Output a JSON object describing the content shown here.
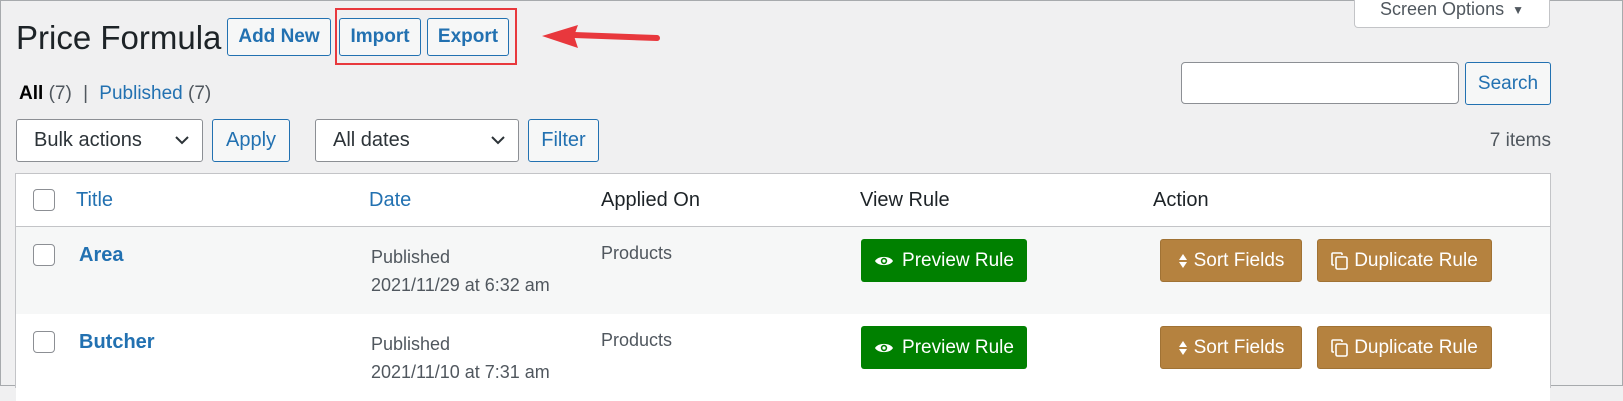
{
  "header": {
    "title": "Price Formula",
    "add_new": "Add New",
    "import": "Import",
    "export": "Export",
    "screen_options": "Screen Options"
  },
  "filters": {
    "all_label": "All",
    "all_count": "(7)",
    "separator": "|",
    "published_label": "Published",
    "published_count": "(7)"
  },
  "search": {
    "button": "Search",
    "value": ""
  },
  "bulk": {
    "selected": "Bulk actions",
    "apply": "Apply"
  },
  "dates": {
    "selected": "All dates",
    "filter": "Filter"
  },
  "items_count": "7 items",
  "table": {
    "columns": {
      "title": "Title",
      "date": "Date",
      "applied_on": "Applied On",
      "view_rule": "View Rule",
      "action": "Action"
    },
    "rows": [
      {
        "title": "Area",
        "status": "Published",
        "date": "2021/11/29 at 6:32 am",
        "applied_on": "Products",
        "preview": "Preview Rule",
        "sort": "Sort Fields",
        "duplicate": "Duplicate Rule"
      },
      {
        "title": "Butcher",
        "status": "Published",
        "date": "2021/11/10 at 7:31 am",
        "applied_on": "Products",
        "preview": "Preview Rule",
        "sort": "Sort Fields",
        "duplicate": "Duplicate Rule"
      }
    ]
  },
  "colors": {
    "accent": "#2271b1",
    "preview_green": "#008000",
    "action_brown": "#b5823f",
    "highlight_red": "#e8383d"
  },
  "icons": {
    "eye": "eye-icon",
    "sort": "sort-icon",
    "duplicate": "duplicate-icon",
    "chevron": "chevron-down-icon",
    "arrow": "arrow-annotation"
  }
}
